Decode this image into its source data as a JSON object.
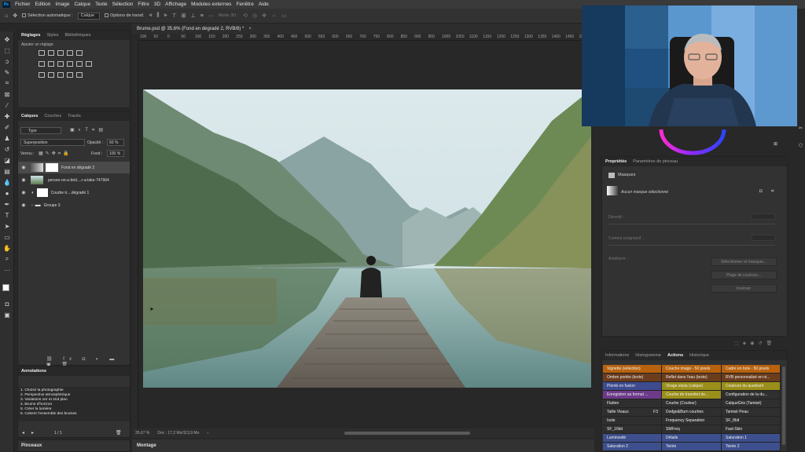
{
  "app": {
    "logo_text": "Ps"
  },
  "menu": [
    "Fichier",
    "Edition",
    "Image",
    "Calque",
    "Texte",
    "Sélection",
    "Filtre",
    "3D",
    "Affichage",
    "Modules externes",
    "Fenêtre",
    "Aide"
  ],
  "options_bar": {
    "auto_select_label": "Sélection automatique :",
    "auto_select_value": "Calque",
    "transform_label": "Options de transf.",
    "mode_3d_label": "Mode 3D :"
  },
  "document": {
    "tab_title": "Brume.psd @ 35,6% (Fond en dégradé 2, RVB/8) *",
    "zoom": "35,67 %",
    "doc_info": "Doc : 17,2 Mo/113,9 Mo",
    "ruler_ticks": [
      "100",
      "50",
      "0",
      "50",
      "100",
      "150",
      "200",
      "250",
      "300",
      "350",
      "400",
      "450",
      "500",
      "550",
      "600",
      "650",
      "700",
      "750",
      "800",
      "850",
      "900",
      "950",
      "1000",
      "1050",
      "1100",
      "1150",
      "1200",
      "1250",
      "1300",
      "1350",
      "1400",
      "1450",
      "1500"
    ]
  },
  "adjustments": {
    "tabs": [
      "Réglages",
      "Styles",
      "Bibliothèques"
    ],
    "active_tab": "Réglages",
    "hint": "Ajouter un réglage"
  },
  "layers": {
    "tabs": [
      "Calques",
      "Couches",
      "Tracés"
    ],
    "active_tab": "Calques",
    "filter_value": "Type",
    "blend_mode": "Superposition",
    "opacity_label": "Opacité :",
    "opacity_value": "60 %",
    "lock_label": "Verrou :",
    "fill_label": "Fond :",
    "fill_value": "100 %",
    "items": [
      {
        "name": "Fond en dégradé 2",
        "selected": true
      },
      {
        "name": "person-on-a-brid....r-a-lake-747964",
        "selected": false
      },
      {
        "name": "Courbe tr....dégradé 1",
        "selected": false
      },
      {
        "name": "Groupe 3",
        "selected": false
      }
    ]
  },
  "annotations": {
    "title": "Annotations",
    "lines": [
      "1. Choisir la photographie",
      "2. Perspective atmosphérique",
      "3. Variations 1er et 2nd plan",
      "4. Brume d'horizon",
      "5. Créer la lumière",
      "6. Colorer l'ensemble des brumes"
    ],
    "page": "1 / 1"
  },
  "bottom_tabs": {
    "left": "Pinceaux",
    "center": "Montage"
  },
  "properties": {
    "tabs": [
      "Propriétés",
      "Paramètres de pinceau"
    ],
    "active_tab": "Propriétés",
    "section": "Masques",
    "mask_status": "Aucun masque sélectionné",
    "density_label": "Densité :",
    "feather_label": "Contour progressif :",
    "refine_label": "Améliorer :",
    "btn_select_mask": "Sélectionner et masquer...",
    "btn_color_range": "Plage de couleurs...",
    "btn_invert": "Inverser"
  },
  "actions_panel": {
    "tabs": [
      "Informations",
      "Histogramme",
      "Actions",
      "Historique"
    ],
    "active_tab": "Actions",
    "rows": [
      [
        {
          "label": "Vignette (sélection)",
          "color": "#b8620e"
        },
        {
          "label": "Couche image - 50 pixels",
          "color": "#b8620e"
        },
        {
          "label": "Cadre en bois - 50 pixels",
          "color": "#b8620e"
        }
      ],
      [
        {
          "label": "Ombre portée (texte)",
          "color": "#6b3d1c"
        },
        {
          "label": "Reflet dans l'eau (texte)",
          "color": "#6b3d1c"
        },
        {
          "label": "RVB personnalisé en ni...",
          "color": "#6b3d1c"
        }
      ],
      [
        {
          "label": "Plomb en fusion",
          "color": "#3e4b8f"
        },
        {
          "label": "Virage sépia (calque)",
          "color": "#9a8f1a"
        },
        {
          "label": "Couleurs du quadrant",
          "color": "#9a8f1a"
        }
      ],
      [
        {
          "label": "Enregistrer au format ...",
          "color": "#6d3a8a"
        },
        {
          "label": "Courbe de transfert de...",
          "color": "#9a8f1a"
        },
        {
          "label": "Configuration de la du...",
          "color": "#2f2f2f"
        }
      ],
      [
        {
          "label": "Flatten",
          "color": "#2f2f2f"
        },
        {
          "label": "Courbe (Couleur)",
          "color": "#2f2f2f"
        },
        {
          "label": "CalqueGris (Tamisé)",
          "color": "#2f2f2f"
        }
      ],
      [
        {
          "label": "Taille Visaux",
          "shortcut": "F3",
          "color": "#2f2f2f"
        },
        {
          "label": "Dodge&Burn courbes",
          "color": "#2f2f2f"
        },
        {
          "label": "Tamisé Peau",
          "color": "#2f2f2f"
        }
      ],
      [
        {
          "label": "Isole",
          "color": "#2f2f2f"
        },
        {
          "label": "Frequency Separation",
          "color": "#2f2f2f"
        },
        {
          "label": "SF_8bit",
          "color": "#2f2f2f"
        }
      ],
      [
        {
          "label": "SF_16bit",
          "color": "#2f2f2f"
        },
        {
          "label": "SMFreq",
          "color": "#2f2f2f"
        },
        {
          "label": "Fast-Skin",
          "color": "#2f2f2f"
        }
      ],
      [
        {
          "label": "Luminosité",
          "color": "#3d4f8c"
        },
        {
          "label": "Détails",
          "color": "#3d4f8c"
        },
        {
          "label": "Saturation 1",
          "color": "#3d4f8c"
        }
      ],
      [
        {
          "label": "Saturation 2",
          "color": "#3d4f8c"
        },
        {
          "label": "Teinte",
          "color": "#3d4f8c"
        },
        {
          "label": "Teinte 2",
          "color": "#3d4f8c"
        }
      ]
    ]
  },
  "colors": {
    "accent": "#31a8ff",
    "panel": "#323232",
    "selected_row": "#4a4a4a"
  }
}
